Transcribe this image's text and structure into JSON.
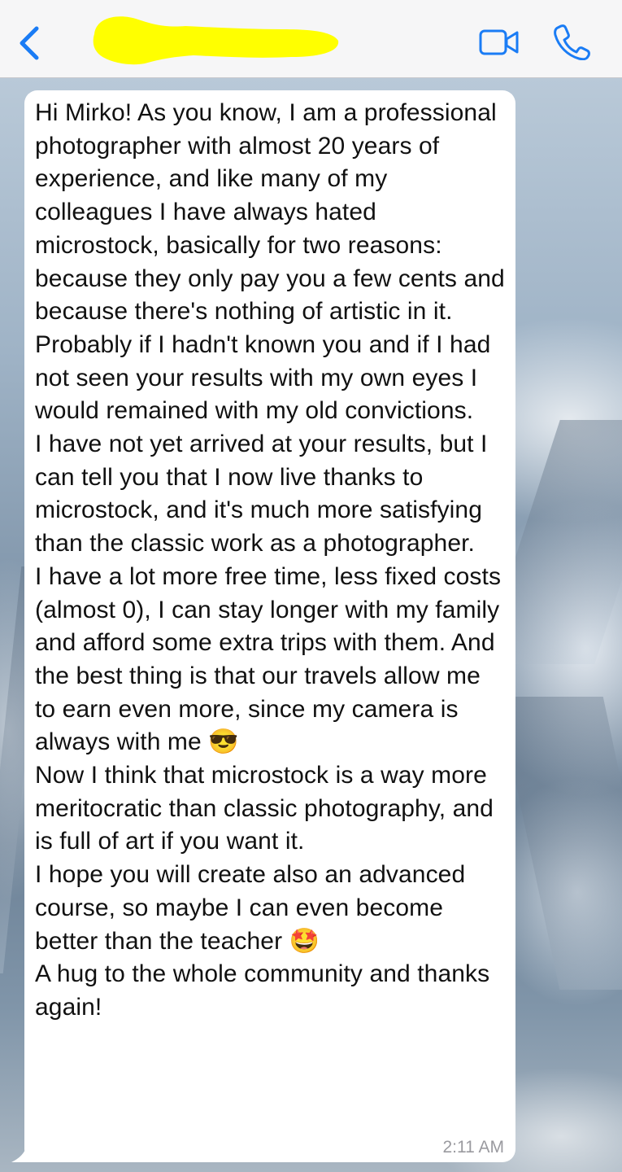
{
  "header": {
    "back_icon": "chevron-left-icon",
    "contact_name": "",
    "video_icon": "video-camera-icon",
    "call_icon": "phone-icon",
    "accent_color": "#1a7cf5",
    "redaction_color": "#ffff00"
  },
  "message": {
    "text": "Hi Mirko! As you know, I am a professional photographer with almost 20 years of experience, and like many of my colleagues I have always hated microstock, basically for two reasons: because they only pay you a few cents and because there's nothing of artistic in it.\nProbably if I hadn't known you and if I had not seen your results with my own eyes I would remained with my old convictions.\nI have not yet arrived at your results, but I can tell you that I now live thanks to microstock, and it's much more satisfying than the classic work as a photographer.\nI have a lot more free time, less fixed costs (almost 0), I can stay longer with my family and afford some extra trips with them. And the best thing is that our travels allow me to earn even more, since my camera is always with me 😎\nNow I think that microstock is a way more meritocratic than classic photography, and is full of art if you want it.\nI hope you will create also an advanced course, so maybe I can even become better than the teacher 🤩\nA hug to the whole community and thanks again!",
    "time": "2:11 AM",
    "bubble_color": "#ffffff"
  }
}
